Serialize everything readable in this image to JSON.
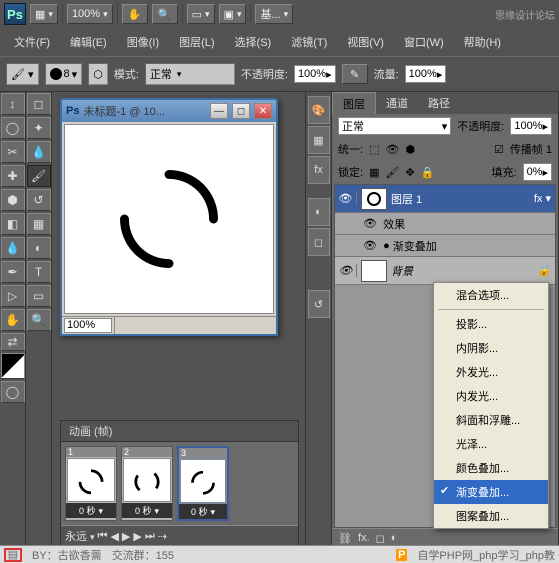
{
  "top": {
    "zoom": "100%",
    "essentials": "基..."
  },
  "watermark": "思缘设计论坛",
  "menu": [
    "文件(F)",
    "编辑(E)",
    "图像(I)",
    "图层(L)",
    "选择(S)",
    "滤镜(T)",
    "视图(V)",
    "窗口(W)",
    "帮助(H)"
  ],
  "options": {
    "brush_size": "8",
    "mode_label": "模式:",
    "mode_value": "正常",
    "opacity_label": "不透明度:",
    "opacity_value": "100%",
    "flow_label": "流量:",
    "flow_value": "100%"
  },
  "document": {
    "title": "未标题-1 @ 10...",
    "zoom": "100%"
  },
  "layers_panel": {
    "tabs": [
      "图层",
      "通道",
      "路径"
    ],
    "blend": "正常",
    "opacity_label": "不透明度:",
    "opacity_value": "100%",
    "unify_label": "统一:",
    "propagate_label": "传播帧 1",
    "lock_label": "锁定:",
    "fill_label": "填充:",
    "fill_value": "0%",
    "layers": [
      {
        "name": "图层 1"
      },
      {
        "name": "效果"
      },
      {
        "name": "渐变叠加"
      },
      {
        "name": "背景"
      }
    ]
  },
  "fx_menu": {
    "items": [
      "混合选项...",
      "sep",
      "投影...",
      "内阴影...",
      "外发光...",
      "内发光...",
      "斜面和浮雕...",
      "光泽...",
      "颜色叠加...",
      "渐变叠加...",
      "图案叠加..."
    ],
    "selected": "渐变叠加..."
  },
  "animation": {
    "tab": "动画 (帧)",
    "frames": [
      {
        "num": "1",
        "dur": "0 秒"
      },
      {
        "num": "2",
        "dur": "0 秒"
      },
      {
        "num": "3",
        "dur": "0 秒"
      }
    ],
    "loop": "永远"
  },
  "status": {
    "by": "BY：古欲香薷",
    "qun": "交流群：155",
    "site": "自学PHP网_php学习_php教"
  }
}
